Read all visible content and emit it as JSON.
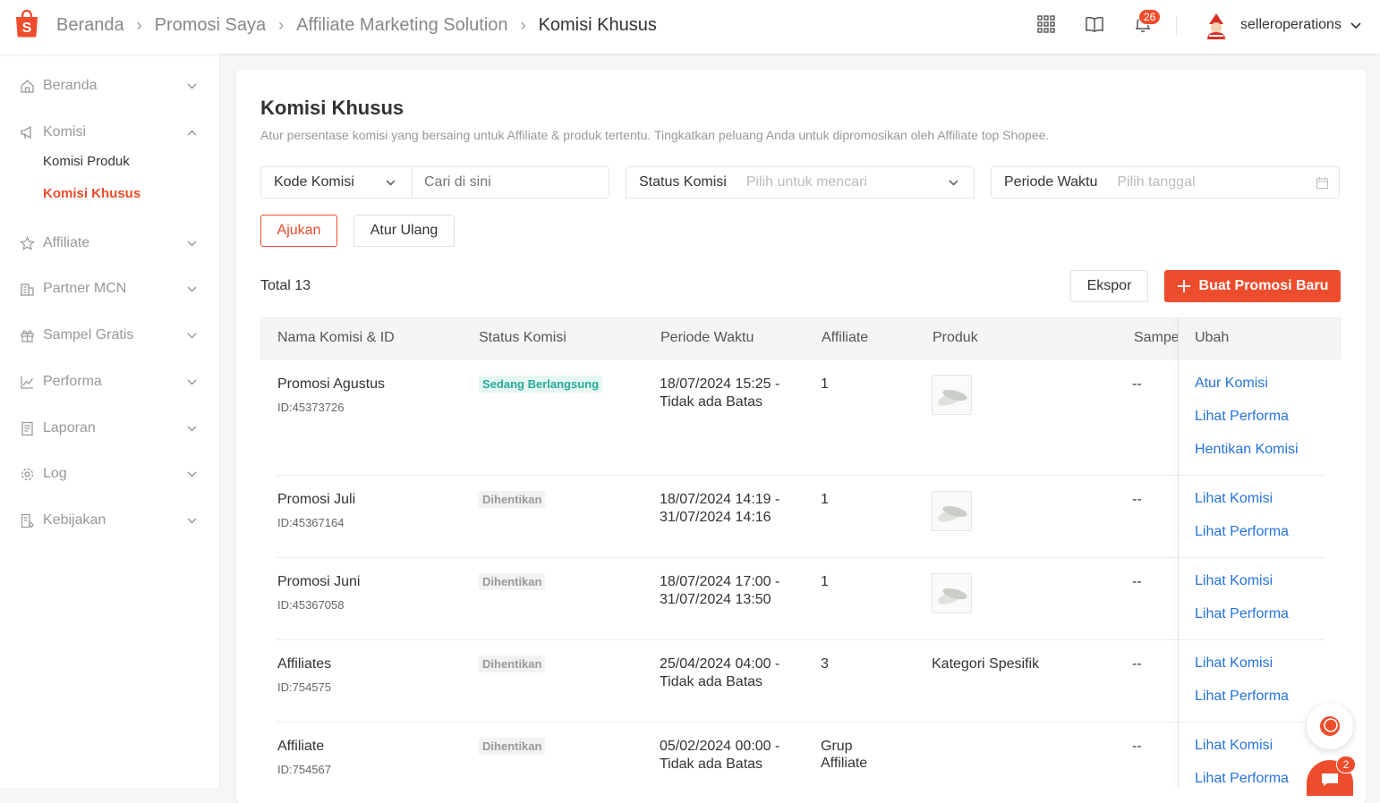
{
  "breadcrumb": [
    "Beranda",
    "Promosi Saya",
    "Affiliate Marketing Solution",
    "Komisi Khusus"
  ],
  "header": {
    "notification_count": "26",
    "username": "selleroperations"
  },
  "sidebar": {
    "items": [
      {
        "label": "Beranda"
      },
      {
        "label": "Komisi"
      },
      {
        "label": "Affiliate"
      },
      {
        "label": "Partner MCN"
      },
      {
        "label": "Sampel Gratis"
      },
      {
        "label": "Performa"
      },
      {
        "label": "Laporan"
      },
      {
        "label": "Log"
      },
      {
        "label": "Kebijakan"
      }
    ],
    "subitems": [
      {
        "label": "Komisi Produk"
      },
      {
        "label": "Komisi Khusus"
      }
    ]
  },
  "page": {
    "title": "Komisi Khusus",
    "subtitle": "Atur persentase komisi yang bersaing untuk Affiliate & produk tertentu. Tingkatkan peluang Anda untuk dipromosikan oleh Affiliate top Shopee."
  },
  "filters": {
    "code_select": "Kode Komisi",
    "search_placeholder": "Cari di sini",
    "status_label": "Status Komisi",
    "status_placeholder": "Pilih untuk mencari",
    "period_label": "Periode Waktu",
    "period_placeholder": "Pilih tanggal",
    "submit": "Ajukan",
    "reset": "Atur Ulang"
  },
  "toolbar": {
    "total": "Total 13",
    "export": "Ekspor",
    "create": "Buat Promosi Baru"
  },
  "table": {
    "headers": [
      "Nama Komisi & ID",
      "Status Komisi",
      "Periode Waktu",
      "Affiliate",
      "Produk",
      "Sampel",
      "Ubah"
    ],
    "rows": [
      {
        "name": "Promosi Agustus",
        "id": "ID:45373726",
        "status": "Sedang Berlangsung",
        "period1": "18/07/2024 15:25 -",
        "period2": "Tidak ada Batas",
        "affiliate1": "1",
        "affiliate2": "",
        "product": "",
        "sample": "--",
        "actions": [
          "Atur Komisi",
          "Lihat Performa",
          "Hentikan Komisi"
        ]
      },
      {
        "name": "Promosi Juli",
        "id": "ID:45367164",
        "status": "Dihentikan",
        "period1": "18/07/2024 14:19 -",
        "period2": "31/07/2024 14:16",
        "affiliate1": "1",
        "affiliate2": "",
        "product": "",
        "sample": "--",
        "actions": [
          "Lihat Komisi",
          "Lihat Performa"
        ]
      },
      {
        "name": "Promosi Juni",
        "id": "ID:45367058",
        "status": "Dihentikan",
        "period1": "18/07/2024 17:00 -",
        "period2": "31/07/2024 13:50",
        "affiliate1": "1",
        "affiliate2": "",
        "product": "",
        "sample": "--",
        "actions": [
          "Lihat Komisi",
          "Lihat Performa"
        ]
      },
      {
        "name": "Affiliates",
        "id": "ID:754575",
        "status": "Dihentikan",
        "period1": "25/04/2024 04:00 -",
        "period2": "Tidak ada Batas",
        "affiliate1": "3",
        "affiliate2": "",
        "product": "Kategori Spesifik",
        "sample": "--",
        "actions": [
          "Lihat Komisi",
          "Lihat Performa"
        ]
      },
      {
        "name": "Affiliate",
        "id": "ID:754567",
        "status": "Dihentikan",
        "period1": "05/02/2024 00:00 -",
        "period2": "Tidak ada Batas",
        "affiliate1": "Grup",
        "affiliate2": "Affiliate",
        "product": "",
        "sample": "--",
        "actions": [
          "Lihat Komisi",
          "Lihat Performa"
        ]
      }
    ]
  },
  "chat": {
    "unread": "2"
  },
  "colors": {
    "brand": "#ee4d2d",
    "link": "#2673dd",
    "active_status": "#26aa99"
  }
}
